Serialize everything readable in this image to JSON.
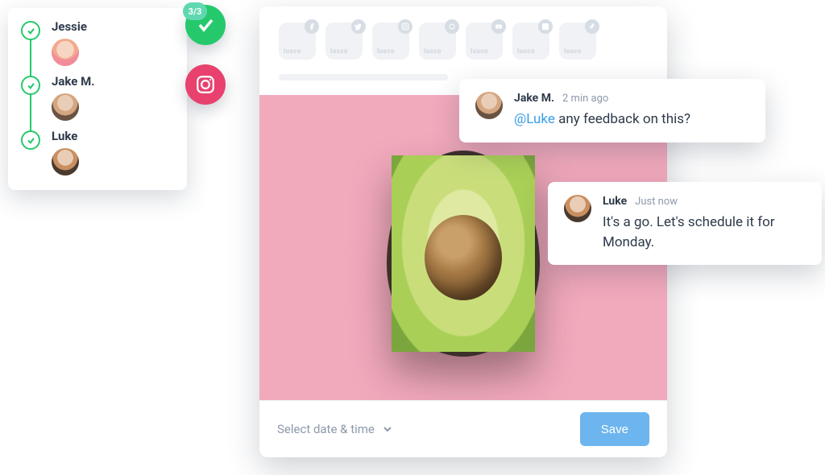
{
  "approvers": [
    {
      "name": "Jessie",
      "avatar": "av-jessie"
    },
    {
      "name": "Jake M.",
      "avatar": "av-jake"
    },
    {
      "name": "Luke",
      "avatar": "av-luke"
    }
  ],
  "approval_badge": {
    "count_label": "3/3"
  },
  "channels": {
    "brand_label": "lusco",
    "networks": [
      "facebook",
      "twitter",
      "instagram",
      "threads",
      "youtube",
      "linkedin",
      "tiktok"
    ]
  },
  "composer": {
    "date_placeholder": "Select date & time",
    "save_label": "Save",
    "image_alt": "avocado-on-pink"
  },
  "comments": [
    {
      "author": "Jake M.",
      "avatar": "av-jake",
      "time": "2 min ago",
      "mention": "@Luke",
      "body": "any feedback on this?"
    },
    {
      "author": "Luke",
      "avatar": "av-luke",
      "time": "Just now",
      "mention": "",
      "body": "It's a go. Let's schedule it for Monday."
    }
  ]
}
